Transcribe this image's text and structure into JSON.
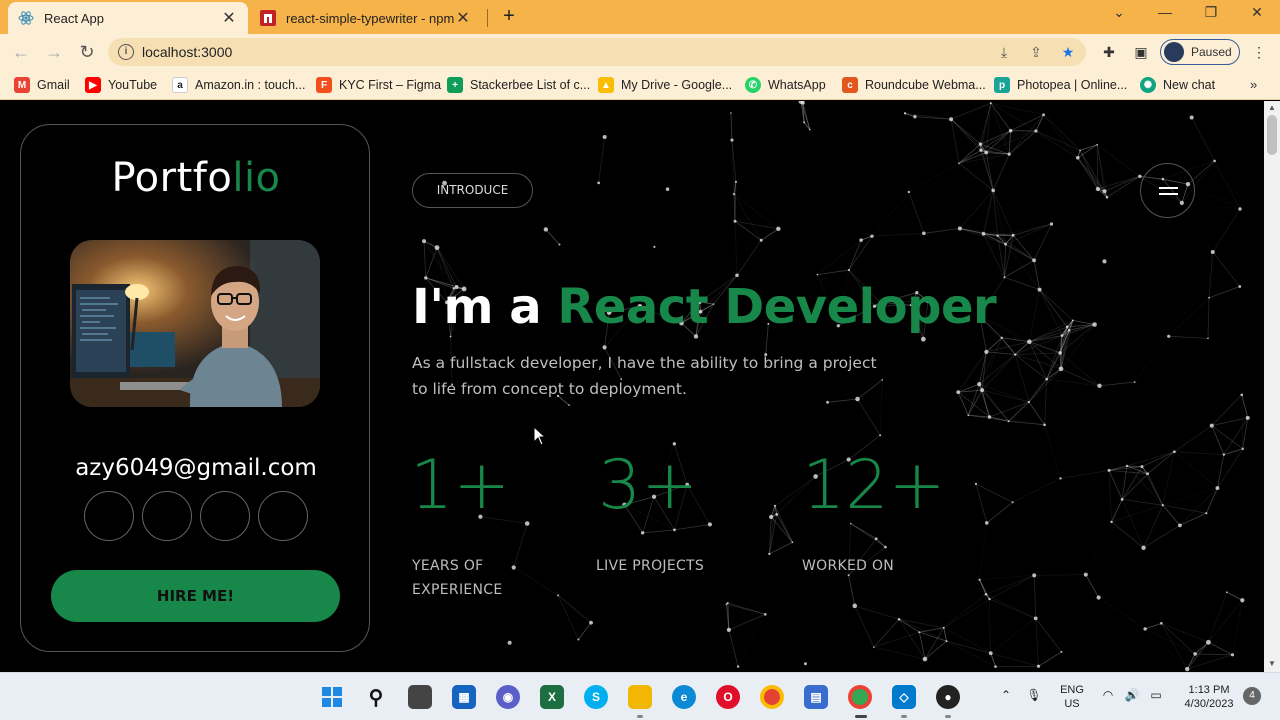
{
  "browser": {
    "tabs": [
      {
        "title": "React App",
        "icon": "react-icon",
        "active": true
      },
      {
        "title": "react-simple-typewriter - npm",
        "icon": "npm-icon",
        "active": false
      }
    ],
    "url": "localhost:3000",
    "profile_label": "Paused",
    "bookmarks": [
      {
        "label": "Gmail",
        "icon": "gmail-icon",
        "color": "#ea4335"
      },
      {
        "label": "YouTube",
        "icon": "youtube-icon",
        "color": "#ff0000"
      },
      {
        "label": "Amazon.in : touch...",
        "icon": "amazon-icon",
        "color": "#222222"
      },
      {
        "label": "KYC First – Figma",
        "icon": "figma-icon",
        "color": "#f24e1e"
      },
      {
        "label": "Stackerbee List of c...",
        "icon": "sheets-icon",
        "color": "#0f9d58"
      },
      {
        "label": "My Drive - Google...",
        "icon": "drive-icon",
        "color": "#fbbc04"
      },
      {
        "label": "WhatsApp",
        "icon": "whatsapp-icon",
        "color": "#25d366"
      },
      {
        "label": "Roundcube Webma...",
        "icon": "roundcube-icon",
        "color": "#e2571e"
      },
      {
        "label": "Photopea | Online...",
        "icon": "photopea-icon",
        "color": "#18a497"
      },
      {
        "label": "New chat",
        "icon": "chatgpt-icon",
        "color": "#10a37f"
      }
    ]
  },
  "page": {
    "logo_main": "Portfo",
    "logo_accent": "lio",
    "email": "azy6049@gmail.com",
    "hire_label": "HIRE ME!",
    "intro_label": "INTRODUCE",
    "headline_prefix": "I'm a ",
    "headline_role": "React Developer",
    "description": "As a fullstack developer, I have the ability to bring a project to life from concept to deployment.",
    "stats": [
      {
        "value": "1+",
        "label_line1": "YEARS OF",
        "label_line2": "EXPERIENCE"
      },
      {
        "value": "3+",
        "label_line1": "LIVE PROJECTS",
        "label_line2": ""
      },
      {
        "value": "12+",
        "label_line1": "WORKED ON",
        "label_line2": ""
      }
    ],
    "accent_color": "#17874a"
  },
  "taskbar": {
    "language": "ENG",
    "region": "US",
    "time": "1:13 PM",
    "date": "4/30/2023",
    "notification_count": "4"
  }
}
